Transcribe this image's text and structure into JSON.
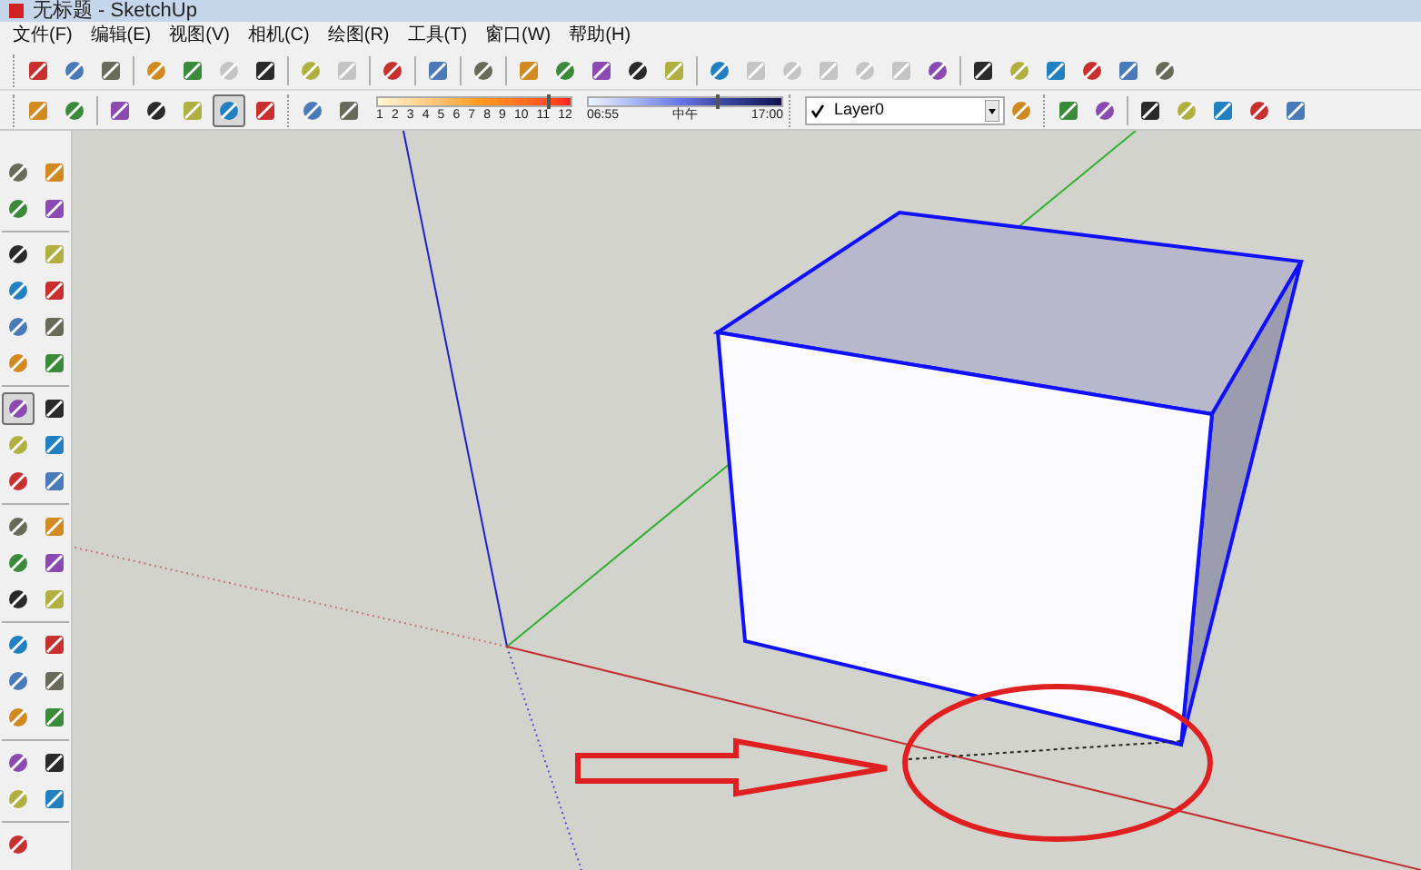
{
  "window": {
    "title": "无标题 - SketchUp"
  },
  "menu": [
    {
      "label": "文件(F)"
    },
    {
      "label": "编辑(E)"
    },
    {
      "label": "视图(V)"
    },
    {
      "label": "相机(C)"
    },
    {
      "label": "绘图(R)"
    },
    {
      "label": "工具(T)"
    },
    {
      "label": "窗口(W)"
    },
    {
      "label": "帮助(H)"
    }
  ],
  "toolbar_1": {
    "groups": [
      [
        {
          "disabled": false
        },
        {
          "disabled": false
        },
        {
          "disabled": false
        }
      ],
      [
        {
          "disabled": false
        },
        {
          "disabled": false
        },
        {
          "disabled": true
        },
        {
          "disabled": false
        }
      ],
      [
        {
          "disabled": false
        },
        {
          "disabled": true
        }
      ],
      [
        {
          "disabled": false
        }
      ],
      [
        {
          "disabled": false
        }
      ],
      [
        {
          "disabled": false
        }
      ],
      [
        {
          "disabled": false
        },
        {
          "disabled": false
        },
        {
          "disabled": false
        },
        {
          "disabled": false
        },
        {
          "disabled": false
        }
      ],
      [
        {
          "disabled": false
        },
        {
          "disabled": true
        },
        {
          "disabled": true
        },
        {
          "disabled": true
        },
        {
          "disabled": true
        },
        {
          "disabled": true
        },
        {
          "disabled": false
        }
      ],
      [
        {
          "disabled": false
        },
        {
          "disabled": false
        },
        {
          "disabled": false
        },
        {
          "disabled": false
        },
        {
          "disabled": false
        },
        {
          "disabled": false
        }
      ]
    ]
  },
  "toolbar_2": {
    "style_buttons": [
      [
        {
          "selected": false
        },
        {
          "selected": false
        }
      ],
      [
        {
          "selected": false
        },
        {
          "selected": false
        },
        {
          "selected": false
        },
        {
          "selected": true
        },
        {
          "selected": false
        }
      ]
    ],
    "shadow_buttons": [
      {
        "selected": false
      },
      {
        "selected": false
      }
    ],
    "month_slider": {
      "labels": [
        "1",
        "2",
        "3",
        "4",
        "5",
        "6",
        "7",
        "8",
        "9",
        "10",
        "11",
        "12"
      ],
      "level": 0.88
    },
    "time_slider": {
      "start": "06:55",
      "middle": "中午",
      "end": "17:00",
      "level": 0.66
    },
    "layer": {
      "checked": true,
      "name": "Layer0"
    },
    "section_buttons": [
      [
        {
          "selected": false
        },
        {
          "selected": false
        }
      ],
      [
        {
          "selected": false
        },
        {
          "selected": false
        },
        {
          "selected": false
        },
        {
          "selected": false
        },
        {
          "selected": false
        }
      ]
    ]
  },
  "left_toolbar": {
    "groups": [
      [
        {
          "selected": false
        },
        {
          "selected": false
        },
        {
          "selected": false
        },
        {
          "selected": false
        }
      ],
      [
        {
          "selected": false
        },
        {
          "selected": false
        },
        {
          "selected": false
        },
        {
          "selected": false
        },
        {
          "selected": false
        },
        {
          "selected": false
        },
        {
          "selected": false
        },
        {
          "selected": false
        }
      ],
      [
        {
          "selected": true
        },
        {
          "selected": false
        },
        {
          "selected": false
        },
        {
          "selected": false
        },
        {
          "selected": false
        },
        {
          "selected": false
        }
      ],
      [
        {
          "selected": false
        },
        {
          "selected": false
        },
        {
          "selected": false
        },
        {
          "selected": false
        },
        {
          "selected": false
        },
        {
          "selected": false
        }
      ],
      [
        {
          "selected": false
        },
        {
          "selected": false
        },
        {
          "selected": false
        },
        {
          "selected": false
        },
        {
          "selected": false
        },
        {
          "selected": false
        }
      ],
      [
        {
          "selected": false
        },
        {
          "selected": false
        },
        {
          "selected": false
        },
        {
          "selected": false
        }
      ],
      [
        {
          "selected": false
        }
      ]
    ]
  }
}
